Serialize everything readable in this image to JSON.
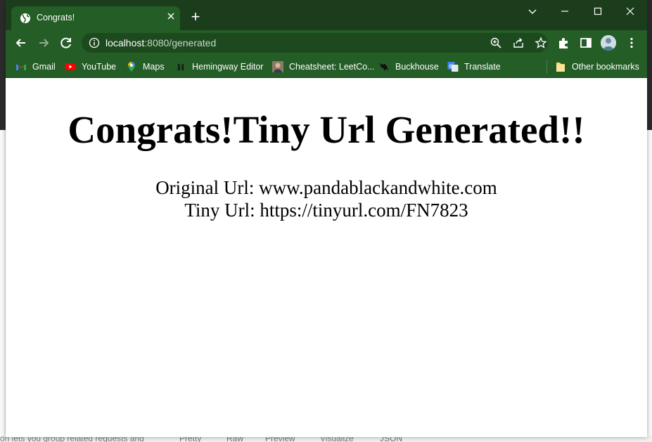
{
  "browser": {
    "tab_title": "Congrats!",
    "new_tab_label": "+",
    "url_host": "localhost",
    "url_path": ":8080/generated",
    "theme_color": "#245d26",
    "titlebar_color": "#1b3d1c"
  },
  "bookmarks": [
    {
      "label": "Gmail",
      "icon": "gmail-icon"
    },
    {
      "label": "YouTube",
      "icon": "youtube-icon"
    },
    {
      "label": "Maps",
      "icon": "maps-icon"
    },
    {
      "label": "Hemingway Editor",
      "icon": "hemingway-icon"
    },
    {
      "label": "Cheatsheet: LeetCo...",
      "icon": "avatar-photo-icon"
    },
    {
      "label": "Buckhouse",
      "icon": "buckhouse-icon"
    },
    {
      "label": "Translate",
      "icon": "translate-icon"
    }
  ],
  "other_bookmarks_label": "Other bookmarks",
  "page": {
    "heading": "Congrats!Tiny Url Generated!!",
    "original_url_line": "Original Url: www.pandablackandwhite.com",
    "tiny_url_line": "Tiny Url: https://tinyurl.com/FN7823"
  },
  "background_app": {
    "bottom_fragment": "on lets you group related requests and",
    "tabs": [
      "Pretty",
      "Raw",
      "Preview",
      "Visualize",
      "JSON"
    ]
  }
}
